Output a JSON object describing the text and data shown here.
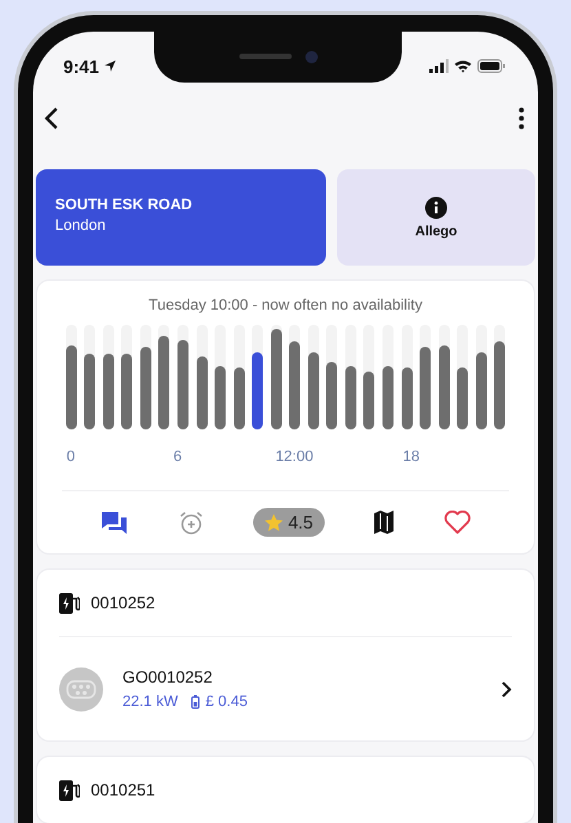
{
  "status_bar": {
    "time": "9:41"
  },
  "location": {
    "name": "SOUTH ESK ROAD",
    "city": "London"
  },
  "operator": {
    "name": "Allego"
  },
  "availability": {
    "title": "Tuesday 10:00 - now often no availability",
    "bars": [
      {
        "level": 0.8,
        "selected": false
      },
      {
        "level": 0.72,
        "selected": false
      },
      {
        "level": 0.72,
        "selected": false
      },
      {
        "level": 0.72,
        "selected": false
      },
      {
        "level": 0.79,
        "selected": false
      },
      {
        "level": 0.89,
        "selected": false
      },
      {
        "level": 0.85,
        "selected": false
      },
      {
        "level": 0.7,
        "selected": false
      },
      {
        "level": 0.6,
        "selected": false
      },
      {
        "level": 0.59,
        "selected": false
      },
      {
        "level": 0.74,
        "selected": true
      },
      {
        "level": 0.96,
        "selected": false
      },
      {
        "level": 0.84,
        "selected": false
      },
      {
        "level": 0.74,
        "selected": false
      },
      {
        "level": 0.64,
        "selected": false
      },
      {
        "level": 0.6,
        "selected": false
      },
      {
        "level": 0.55,
        "selected": false
      },
      {
        "level": 0.6,
        "selected": false
      },
      {
        "level": 0.59,
        "selected": false
      },
      {
        "level": 0.79,
        "selected": false
      },
      {
        "level": 0.8,
        "selected": false
      },
      {
        "level": 0.59,
        "selected": false
      },
      {
        "level": 0.74,
        "selected": false
      },
      {
        "level": 0.84,
        "selected": false
      }
    ],
    "axis_labels": [
      "0",
      "6",
      "12:00",
      "18"
    ]
  },
  "actions": {
    "rating": "4.5",
    "favorite": false
  },
  "connectors": [
    {
      "id": "0010252",
      "points": [
        {
          "name": "GO0010252",
          "power": "22.1 kW",
          "price": "£ 0.45"
        }
      ]
    },
    {
      "id": "0010251"
    }
  ]
}
